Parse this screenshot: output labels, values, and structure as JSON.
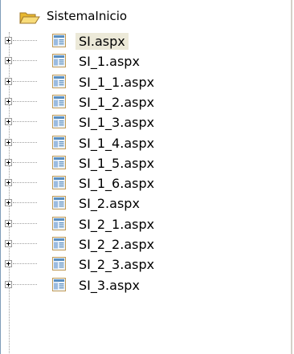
{
  "tree": {
    "root": {
      "label": "SistemaInicio",
      "icon": "folder-open-icon"
    },
    "items": [
      {
        "label": "SI.aspx",
        "selected": true
      },
      {
        "label": "SI_1.aspx",
        "selected": false
      },
      {
        "label": "SI_1_1.aspx",
        "selected": false
      },
      {
        "label": "SI_1_2.aspx",
        "selected": false
      },
      {
        "label": "SI_1_3.aspx",
        "selected": false
      },
      {
        "label": "SI_1_4.aspx",
        "selected": false
      },
      {
        "label": "SI_1_5.aspx",
        "selected": false
      },
      {
        "label": "SI_1_6.aspx",
        "selected": false
      },
      {
        "label": "SI_2.aspx",
        "selected": false
      },
      {
        "label": "SI_2_1.aspx",
        "selected": false
      },
      {
        "label": "SI_2_2.aspx",
        "selected": false
      },
      {
        "label": "SI_2_3.aspx",
        "selected": false
      },
      {
        "label": "SI_3.aspx",
        "selected": false
      }
    ],
    "item_icon": "aspx-page-icon",
    "expander_icon": "plus-expander-icon"
  },
  "colors": {
    "selection": "#ece9d8",
    "folder": "#f3c94f",
    "page_icon": "#5a8fc0"
  }
}
